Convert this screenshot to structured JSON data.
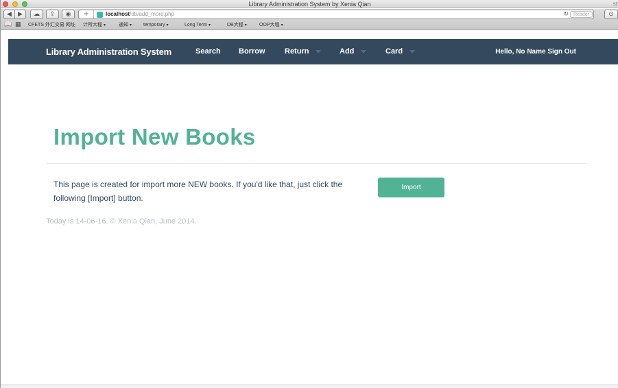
{
  "window": {
    "title": "Library Administration System by Xenia Qian",
    "title_right": "st",
    "traffic_colors": [
      "#ef5a52",
      "#f4bd3e",
      "#5fc653"
    ]
  },
  "browser": {
    "back_glyph": "◀",
    "forward_glyph": "▶",
    "cloud_glyph": "☁",
    "share_glyph": "⇪",
    "pin_glyph": "◉",
    "addr_plus": "+",
    "address_host": "localhost",
    "address_path": "/db/add_more.php",
    "reload_glyph": "↻",
    "reader_label": "Reader",
    "download_glyph": "⊙",
    "bookmarks": [
      {
        "label": "CFETS 外汇交易 网址",
        "caret": ""
      },
      {
        "label": "计所大程",
        "caret": "▾"
      },
      {
        "label": "通知",
        "caret": "▾"
      },
      {
        "label": "temporary",
        "caret": "▾"
      },
      {
        "label": "Long Term",
        "caret": "▾"
      },
      {
        "label": "DB大程",
        "caret": "▾"
      },
      {
        "label": "OOP大程",
        "caret": "▾"
      }
    ],
    "bookmark_icons": [
      "📖",
      "▦"
    ]
  },
  "navbar": {
    "brand": "Library Administration System",
    "items": [
      {
        "label": "Search",
        "dropdown": false
      },
      {
        "label": "Borrow",
        "dropdown": false
      },
      {
        "label": "Return",
        "dropdown": true
      },
      {
        "label": "Add",
        "dropdown": true
      },
      {
        "label": "Card",
        "dropdown": true
      }
    ],
    "greeting": "Hello, No Name Sign Out",
    "bg_color": "#34495e"
  },
  "main": {
    "title": "Import New Books",
    "description": "This page is created for import more NEW books. If you'd like that, just click the following [Import] button.",
    "import_label": "Import",
    "accent_color": "#52b394"
  },
  "footer": {
    "text": "Today is 14-06-16.  © Xenia Qian, June 2014."
  }
}
